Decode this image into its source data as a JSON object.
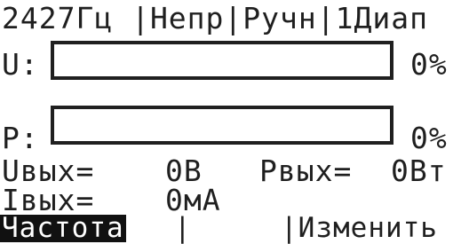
{
  "status_line": "2427Гц |Непр|Ручн|1Диап",
  "indicators": {
    "u": {
      "label": "U:",
      "percent_text": "0%",
      "level": 0
    },
    "p": {
      "label": "P:",
      "percent_text": "0%",
      "level": 0
    }
  },
  "readouts": {
    "uout_label": "Uвых=",
    "uout_value": "0В",
    "pout_label": "Pвых=",
    "pout_value": "0Вт",
    "iout_label": "Iвых=",
    "iout_value": "0мА"
  },
  "softkeys": {
    "left": "Частота",
    "separator": "|",
    "right": "|Изменить"
  },
  "colors": {
    "foreground": "#1f1f1f",
    "background": "#ffffff",
    "highlight": "#111111"
  }
}
